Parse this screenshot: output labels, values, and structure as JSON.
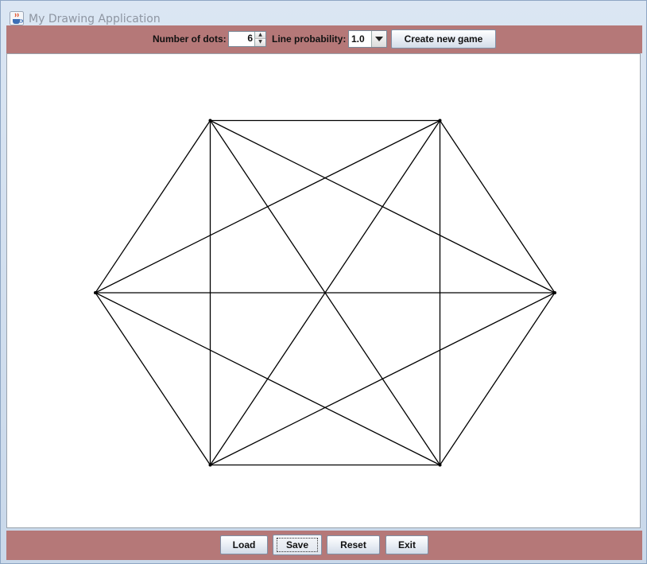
{
  "window": {
    "title": "My Drawing Application",
    "icon": "java-cup-icon"
  },
  "toolbar": {
    "dots_label": "Number of dots:",
    "dots_value": "6",
    "probability_label": "Line probability:",
    "probability_value": "1.0",
    "create_button": "Create new game"
  },
  "drawing": {
    "dot_count": 6,
    "line_probability": 1.0,
    "line_color": "#000000",
    "edges": "complete-graph"
  },
  "bottom": {
    "load_button": "Load",
    "save_button": "Save",
    "reset_button": "Reset",
    "exit_button": "Exit"
  },
  "colors": {
    "panel": "#b57878",
    "canvas": "#ffffff"
  }
}
